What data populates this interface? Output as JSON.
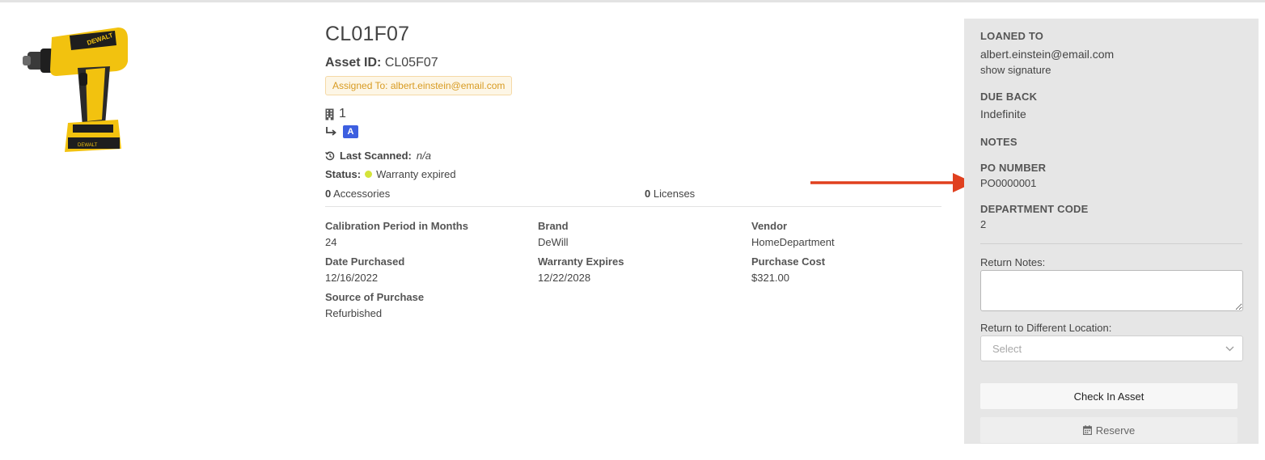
{
  "asset": {
    "name": "CL01F07",
    "asset_id_label": "Asset ID:",
    "asset_id": "CL05F07",
    "assigned_to": "Assigned To: albert.einstein@email.com",
    "building_number": "1",
    "location_badge": "A",
    "last_scanned_label": "Last Scanned:",
    "last_scanned_value": "n/a",
    "status_label": "Status:",
    "status_value": "Warranty expired",
    "status_color": "#d4e43a",
    "accessories_count": "0",
    "accessories_label": "Accessories",
    "licenses_count": "0",
    "licenses_label": "Licenses"
  },
  "fields": [
    {
      "label": "Calibration Period in Months",
      "value": "24"
    },
    {
      "label": "Brand",
      "value": "DeWill"
    },
    {
      "label": "Vendor",
      "value": "HomeDepartment"
    },
    {
      "label": "Date Purchased",
      "value": "12/16/2022"
    },
    {
      "label": "Warranty Expires",
      "value": "12/22/2028"
    },
    {
      "label": "Purchase Cost",
      "value": "$321.00"
    },
    {
      "label": "Source of Purchase",
      "value": "Refurbished"
    }
  ],
  "sidebar": {
    "loaned_to_label": "LOANED TO",
    "loaned_to_value": "albert.einstein@email.com",
    "show_signature": "show signature",
    "due_back_label": "DUE BACK",
    "due_back_value": "Indefinite",
    "notes_label": "NOTES",
    "po_label": "PO NUMBER",
    "po_value": "PO0000001",
    "dept_label": "DEPARTMENT CODE",
    "dept_value": "2",
    "return_notes_label": "Return Notes:",
    "return_location_label": "Return to Different Location:",
    "select_placeholder": "Select",
    "checkin_button": "Check In Asset",
    "reserve_button": "Reserve"
  },
  "icons": {
    "building": "building-icon",
    "sublocation": "arrow-turn-down-right-icon",
    "history": "history-icon",
    "calendar": "calendar-icon",
    "chevron": "chevron-down-icon"
  },
  "colors": {
    "accent_blue": "#3d5fe0",
    "assigned_text": "#d89b22",
    "annotation_arrow": "#e0401f"
  }
}
